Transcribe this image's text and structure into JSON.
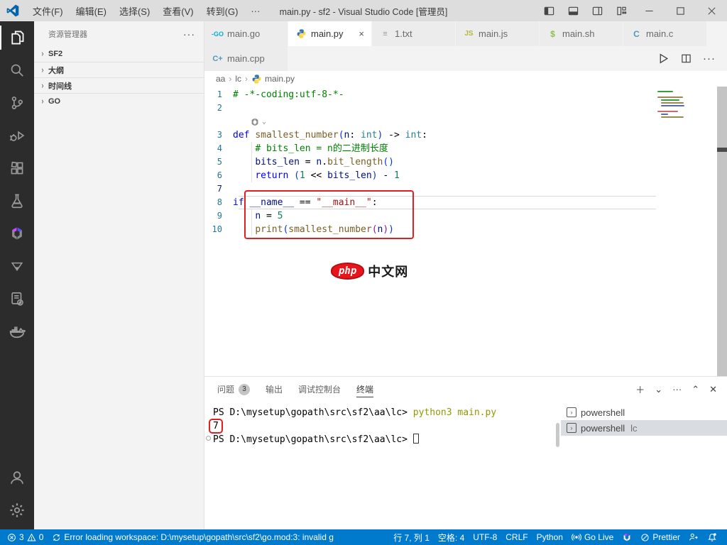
{
  "titlebar": {
    "menus": [
      "文件(F)",
      "编辑(E)",
      "选择(S)",
      "查看(V)",
      "转到(G)",
      "···"
    ],
    "title": "main.py - sf2 - Visual Studio Code [管理员]",
    "window_buttons": [
      "layout-sidebar",
      "layout-panel",
      "layout-sidebar-right",
      "layout-custom",
      "minimize",
      "maximize",
      "close"
    ]
  },
  "activity_bar": {
    "top": [
      {
        "name": "explorer",
        "active": true
      },
      {
        "name": "search"
      },
      {
        "name": "source-control"
      },
      {
        "name": "run-debug"
      },
      {
        "name": "extensions"
      },
      {
        "name": "testing"
      },
      {
        "name": "tabnine"
      },
      {
        "name": "triangle"
      },
      {
        "name": "code-doc"
      },
      {
        "name": "docker"
      }
    ],
    "bottom": [
      {
        "name": "account"
      },
      {
        "name": "settings"
      }
    ]
  },
  "sidebar": {
    "header": "资源管理器",
    "more": "···",
    "sections": [
      "SF2",
      "大纲",
      "时间线",
      "GO"
    ]
  },
  "tabs": {
    "row1": [
      {
        "label": "main.go",
        "icon": "go"
      },
      {
        "label": "main.py",
        "icon": "python",
        "active": true,
        "close": "×"
      },
      {
        "label": "1.txt",
        "icon": "txt"
      },
      {
        "label": "main.js",
        "icon": "js"
      },
      {
        "label": "main.sh",
        "icon": "sh"
      },
      {
        "label": "main.c",
        "icon": "c"
      }
    ],
    "row2": [
      {
        "label": "main.cpp",
        "icon": "cpp"
      }
    ],
    "actions": [
      "run",
      "split",
      "more"
    ]
  },
  "breadcrumb": [
    "aa",
    "lc",
    "main.py"
  ],
  "editor": {
    "hint_after_line": 2,
    "current_line": 7,
    "lines": [
      {
        "num": 1,
        "segments": [
          {
            "t": "# -*-coding:utf-8-*-",
            "k": "com"
          }
        ]
      },
      {
        "num": 2,
        "segments": []
      },
      {
        "num": 3,
        "segments": [
          {
            "t": "def ",
            "k": "kw"
          },
          {
            "t": "smallest_number",
            "k": "fn"
          },
          {
            "t": "(",
            "k": "p1"
          },
          {
            "t": "n",
            "k": "vr"
          },
          {
            "t": ": ",
            "k": "fg"
          },
          {
            "t": "int",
            "k": "ty"
          },
          {
            "t": ")",
            "k": "p1"
          },
          {
            "t": " -> ",
            "k": "fg"
          },
          {
            "t": "int",
            "k": "ty"
          },
          {
            "t": ":",
            "k": "fg"
          }
        ]
      },
      {
        "num": 4,
        "segments": [
          {
            "t": "    ",
            "k": "fg"
          },
          {
            "t": "# bits_len = n的二进制长度",
            "k": "com"
          }
        ]
      },
      {
        "num": 5,
        "segments": [
          {
            "t": "    ",
            "k": "fg"
          },
          {
            "t": "bits_len",
            "k": "vr"
          },
          {
            "t": " = ",
            "k": "fg"
          },
          {
            "t": "n",
            "k": "vr"
          },
          {
            "t": ".",
            "k": "fg"
          },
          {
            "t": "bit_length",
            "k": "fn"
          },
          {
            "t": "()",
            "k": "p1"
          }
        ]
      },
      {
        "num": 6,
        "segments": [
          {
            "t": "    ",
            "k": "fg"
          },
          {
            "t": "return",
            "k": "kw"
          },
          {
            "t": " ",
            "k": "fg"
          },
          {
            "t": "(",
            "k": "p1"
          },
          {
            "t": "1",
            "k": "nm"
          },
          {
            "t": " << ",
            "k": "fg"
          },
          {
            "t": "bits_len",
            "k": "vr"
          },
          {
            "t": ")",
            "k": "p1"
          },
          {
            "t": " - ",
            "k": "fg"
          },
          {
            "t": "1",
            "k": "nm"
          }
        ]
      },
      {
        "num": 7,
        "segments": []
      },
      {
        "num": 8,
        "segments": [
          {
            "t": "if ",
            "k": "kw"
          },
          {
            "t": "__name__",
            "k": "vr"
          },
          {
            "t": " == ",
            "k": "fg"
          },
          {
            "t": "\"__main__\"",
            "k": "st"
          },
          {
            "t": ":",
            "k": "fg"
          }
        ]
      },
      {
        "num": 9,
        "segments": [
          {
            "t": "    ",
            "k": "fg"
          },
          {
            "t": "n",
            "k": "vr"
          },
          {
            "t": " = ",
            "k": "fg"
          },
          {
            "t": "5",
            "k": "nm"
          }
        ]
      },
      {
        "num": 10,
        "segments": [
          {
            "t": "    ",
            "k": "fg"
          },
          {
            "t": "print",
            "k": "fn"
          },
          {
            "t": "(",
            "k": "p1"
          },
          {
            "t": "smallest_number",
            "k": "fn"
          },
          {
            "t": "(",
            "k": "p2"
          },
          {
            "t": "n",
            "k": "vr"
          },
          {
            "t": ")",
            "k": "p2"
          },
          {
            "t": ")",
            "k": "p1"
          }
        ]
      }
    ]
  },
  "watermark": {
    "badge": "php",
    "text": "中文网"
  },
  "panel": {
    "tabs": [
      {
        "label": "问题",
        "badge": "3"
      },
      {
        "label": "输出"
      },
      {
        "label": "调试控制台"
      },
      {
        "label": "终端",
        "active": true
      }
    ],
    "actions": [
      "＋",
      "⌄",
      "···",
      "⌃",
      "✕"
    ]
  },
  "terminal": {
    "lines": [
      {
        "segments": [
          {
            "t": "PS D:\\mysetup\\gopath\\src\\sf2\\aa\\lc> ",
            "k": "fg"
          },
          {
            "t": "python3 main.py",
            "k": "cmd"
          }
        ]
      },
      {
        "segments": [
          {
            "t": "7",
            "k": "fg",
            "box": true
          }
        ]
      },
      {
        "decoration": "circle",
        "segments": [
          {
            "t": "PS D:\\mysetup\\gopath\\src\\sf2\\aa\\lc> ",
            "k": "fg"
          },
          {
            "t": "",
            "k": "cursor"
          }
        ]
      }
    ],
    "list": [
      {
        "icon": "›",
        "label": "powershell",
        "suffix": ""
      },
      {
        "icon": "›",
        "label": "powershell",
        "suffix": "lc",
        "selected": true
      }
    ]
  },
  "statusbar": {
    "left": [
      {
        "icon": "error",
        "label": "3",
        "icon2": "warning",
        "label2": "0"
      },
      {
        "icon": "sync",
        "label": "Error loading workspace: D:\\mysetup\\gopath\\src\\sf2\\go.mod:3: invalid g"
      }
    ],
    "right": [
      {
        "label": "行 7, 列 1"
      },
      {
        "label": "空格: 4"
      },
      {
        "label": "UTF-8"
      },
      {
        "label": "CRLF"
      },
      {
        "label": "Python"
      },
      {
        "icon": "broadcast",
        "label": "Go Live"
      },
      {
        "icon": "tabnine",
        "label": ""
      },
      {
        "icon": "prettier",
        "label": "Prettier"
      },
      {
        "icon": "person",
        "label": ""
      },
      {
        "icon": "bell",
        "label": ""
      }
    ]
  }
}
